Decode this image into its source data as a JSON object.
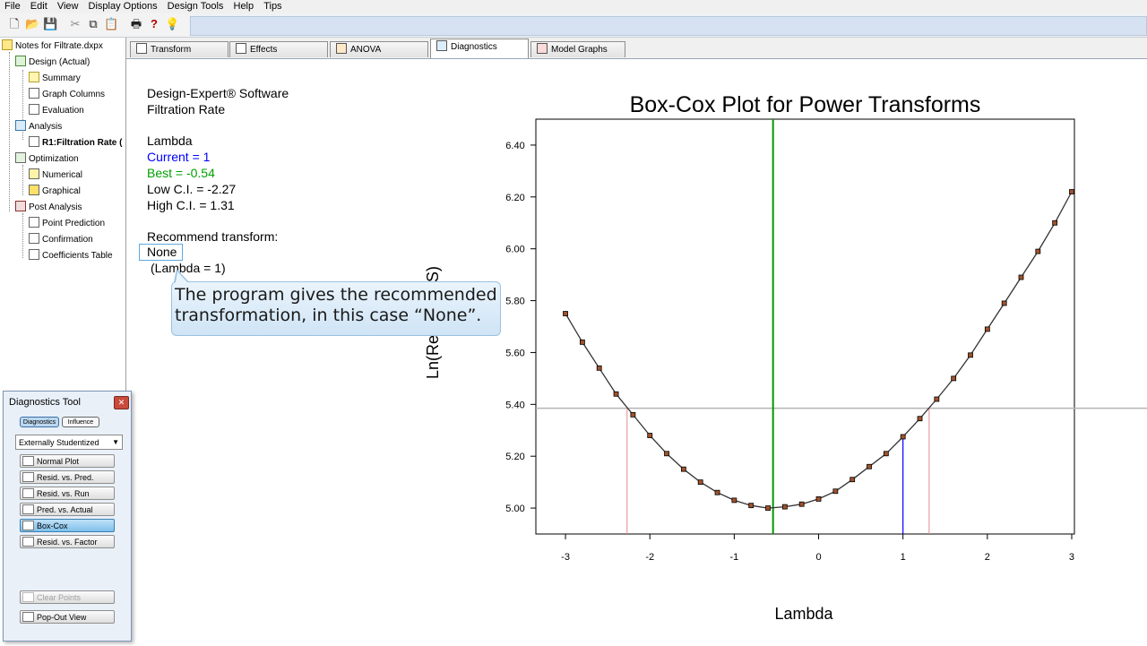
{
  "menu": [
    "File",
    "Edit",
    "View",
    "Display Options",
    "Design Tools",
    "Help",
    "Tips"
  ],
  "tree": {
    "root": "Notes for Filtrate.dxpx",
    "items": [
      {
        "label": "Design (Actual)"
      },
      {
        "label": "Summary"
      },
      {
        "label": "Graph Columns"
      },
      {
        "label": "Evaluation"
      },
      {
        "label": "Analysis"
      },
      {
        "label": "R1:Filtration Rate (",
        "bold": true
      },
      {
        "label": "Optimization"
      },
      {
        "label": "Numerical"
      },
      {
        "label": "Graphical"
      },
      {
        "label": "Post Analysis"
      },
      {
        "label": "Point Prediction"
      },
      {
        "label": "Confirmation"
      },
      {
        "label": "Coefficients Table"
      }
    ]
  },
  "tabs": [
    {
      "label": "Transform",
      "active": false
    },
    {
      "label": "Effects",
      "active": false
    },
    {
      "label": "ANOVA",
      "active": false
    },
    {
      "label": "Diagnostics",
      "active": true
    },
    {
      "label": "Model Graphs",
      "active": false
    }
  ],
  "info": {
    "software": "Design-Expert® Software",
    "response": "Filtration Rate",
    "lambda_title": "Lambda",
    "current": "Current = 1",
    "best": "Best = -0.54",
    "low_ci": "Low C.I. = -2.27",
    "high_ci": "High C.I. = 1.31",
    "recommend": "Recommend transform:",
    "transform": "None",
    "lambda_note": "(Lambda = 1)"
  },
  "callout": {
    "line1": "The program gives the recommended",
    "line2": "transformation, in this case “None”."
  },
  "diagnostics_tool": {
    "title": "Diagnostics Tool",
    "tabs": [
      "Diagnostics",
      "Influence"
    ],
    "dropdown": "Externally Studentized",
    "buttons": [
      "Normal Plot",
      "Resid. vs. Pred.",
      "Resid. vs. Run",
      "Pred. vs. Actual",
      "Box-Cox",
      "Resid. vs. Factor"
    ],
    "selected": "Box-Cox",
    "clear_points": "Clear Points",
    "popout": "Pop-Out View"
  },
  "colors": {
    "current_blue": "#0000ff",
    "best_green": "#009900",
    "ci_red": "#e88a8a",
    "threshold_gray": "#b4b4b4"
  },
  "chart_data": {
    "type": "line",
    "title": "Box-Cox Plot for Power Transforms",
    "xlabel": "Lambda",
    "ylabel": "Ln(ResidualSS)",
    "xlim": [
      -3,
      3
    ],
    "ylim": [
      4.9,
      6.5
    ],
    "xticks": [
      -3,
      -2,
      -1,
      0,
      1,
      2,
      3
    ],
    "yticks": [
      5.0,
      5.2,
      5.4,
      5.6,
      5.8,
      6.0,
      6.2,
      6.4
    ],
    "x": [
      -3.0,
      -2.8,
      -2.6,
      -2.4,
      -2.2,
      -2.0,
      -1.8,
      -1.6,
      -1.4,
      -1.2,
      -1.0,
      -0.8,
      -0.6,
      -0.4,
      -0.2,
      0.0,
      0.2,
      0.4,
      0.6,
      0.8,
      1.0,
      1.2,
      1.4,
      1.6,
      1.8,
      2.0,
      2.2,
      2.4,
      2.6,
      2.8,
      3.0
    ],
    "y": [
      5.75,
      5.64,
      5.54,
      5.44,
      5.36,
      5.28,
      5.21,
      5.15,
      5.1,
      5.06,
      5.03,
      5.01,
      5.0,
      5.005,
      5.015,
      5.035,
      5.065,
      5.11,
      5.16,
      5.21,
      5.275,
      5.345,
      5.42,
      5.5,
      5.59,
      5.69,
      5.79,
      5.89,
      5.99,
      6.1,
      6.22
    ],
    "current": 1,
    "best": -0.54,
    "low_ci": -2.27,
    "high_ci": 1.31,
    "ci_threshold": 5.385
  }
}
